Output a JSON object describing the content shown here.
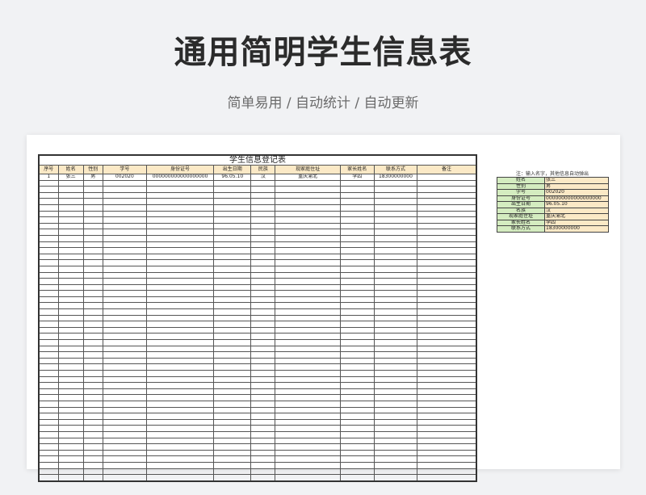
{
  "title": "通用简明学生信息表",
  "subtitle": "简单易用 / 自动统计 / 自动更新",
  "sheet": {
    "caption": "学生信息登记表",
    "columns": [
      "序号",
      "姓名",
      "性别",
      "学号",
      "身份证号",
      "出生日期",
      "民族",
      "现家庭住址",
      "家长姓名",
      "联系方式",
      "备注"
    ],
    "rows": [
      [
        "1",
        "张三",
        "男",
        "002020",
        "000000000000000000",
        "96.05.10",
        "汉",
        "重庆渝北",
        "李四",
        "18300000000",
        ""
      ]
    ],
    "empty_row_count": 49
  },
  "lookup": {
    "note": "注：输入名字，其他信息自动弹出",
    "fields": [
      {
        "label": "姓名",
        "value": "张三"
      },
      {
        "label": "性别",
        "value": "男"
      },
      {
        "label": "学号",
        "value": "002020"
      },
      {
        "label": "身份证号",
        "value": "000000000000000000"
      },
      {
        "label": "出生日期",
        "value": "96.05.10"
      },
      {
        "label": "名族",
        "value": "汉"
      },
      {
        "label": "现家庭住址",
        "value": "重庆渝北"
      },
      {
        "label": "家长姓名",
        "value": "李四"
      },
      {
        "label": "联系方式",
        "value": "18300000000"
      }
    ]
  },
  "colors": {
    "header_fill": "#fbe9c6",
    "label_fill": "#d4ecc0",
    "background": "#f1f2f4"
  }
}
